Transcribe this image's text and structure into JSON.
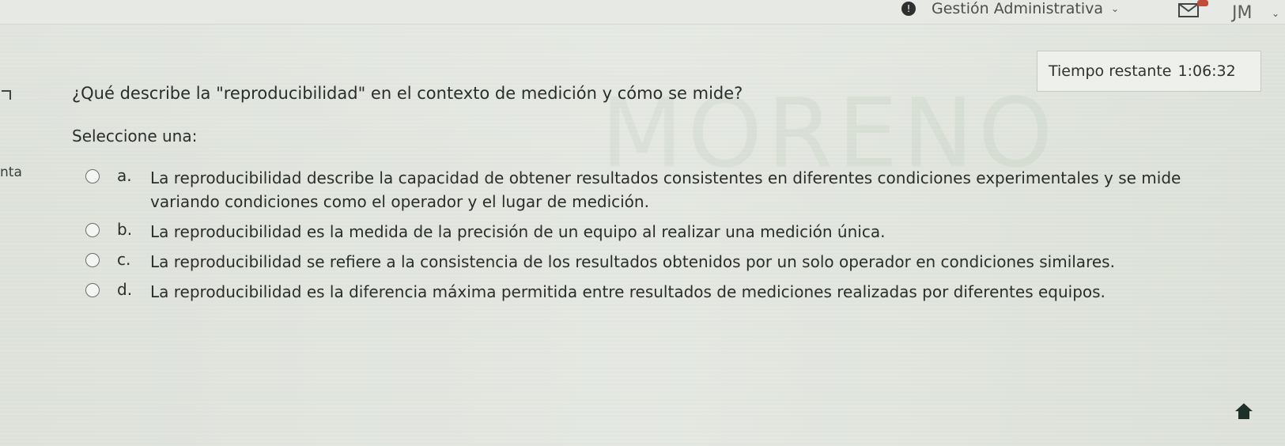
{
  "topbar": {
    "alert": "!",
    "role_label": "Gestión Administrativa",
    "user_initials": "JM"
  },
  "sidebar": {
    "partial_label": "nta"
  },
  "timer": {
    "label": "Tiempo restante",
    "value": "1:06:32"
  },
  "question": {
    "text": "¿Qué describe la \"reproducibilidad\" en el contexto de medición y cómo se mide?",
    "prompt": "Seleccione una:",
    "options": [
      {
        "letter": "a.",
        "text": "La reproducibilidad describe la capacidad de obtener resultados consistentes en diferentes condiciones experimentales y se mide variando condiciones como el operador y el lugar de medición."
      },
      {
        "letter": "b.",
        "text": "La reproducibilidad es la medida de la precisión de un equipo al realizar una medición única."
      },
      {
        "letter": "c.",
        "text": "La reproducibilidad se refiere a la consistencia de los resultados obtenidos por un solo operador en condiciones similares."
      },
      {
        "letter": "d.",
        "text": "La reproducibilidad es la diferencia máxima permitida entre resultados de mediciones realizadas por diferentes equipos."
      }
    ]
  },
  "colors": {
    "background": "#e2e6df",
    "text": "#2a2e2b",
    "badge": "#c24a3a"
  },
  "icons": {
    "mail": "mail-icon",
    "home": "home-icon",
    "chevron": "chevron-down-icon",
    "radio": "radio-icon"
  }
}
